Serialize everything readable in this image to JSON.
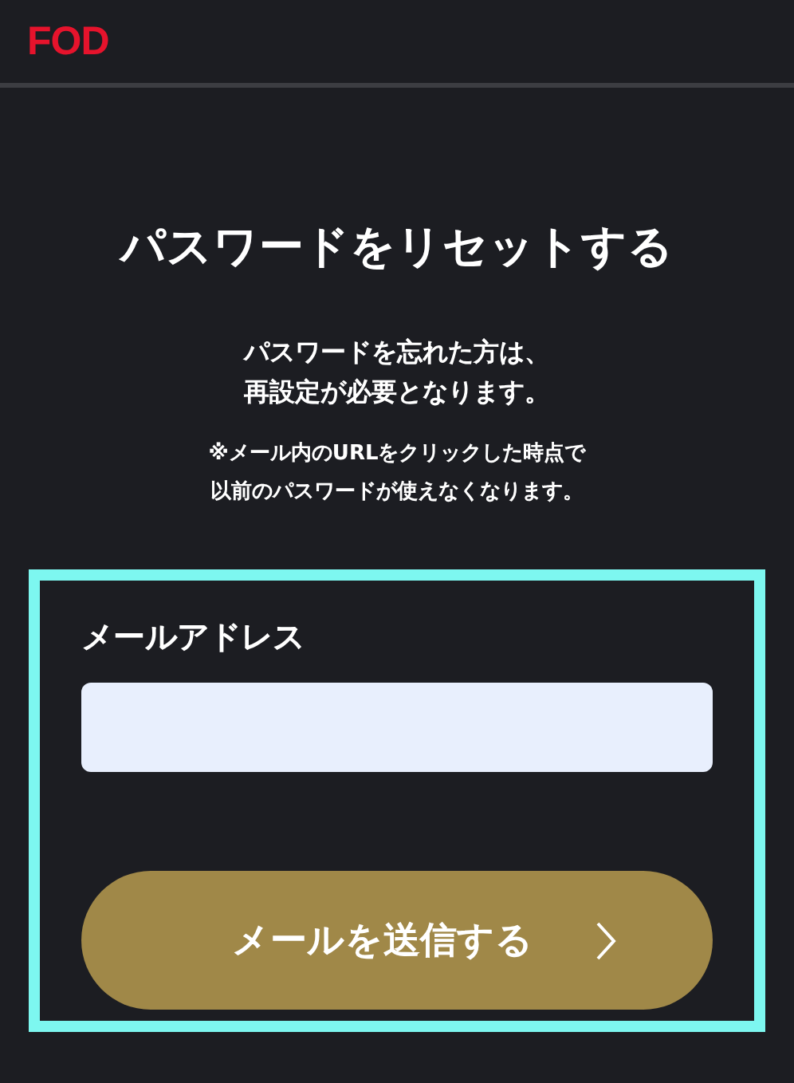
{
  "header": {
    "logo": "FOD"
  },
  "title": "パスワードをリセットする",
  "description": [
    "パスワードを忘れた方は、",
    "再設定が必要となります。"
  ],
  "note": [
    "※メール内のURLをクリックした時点で",
    "以前のパスワードが使えなくなります。"
  ],
  "form": {
    "highlighted": true,
    "email_label": "メールアドレス",
    "submit": "メールを送信する"
  }
}
